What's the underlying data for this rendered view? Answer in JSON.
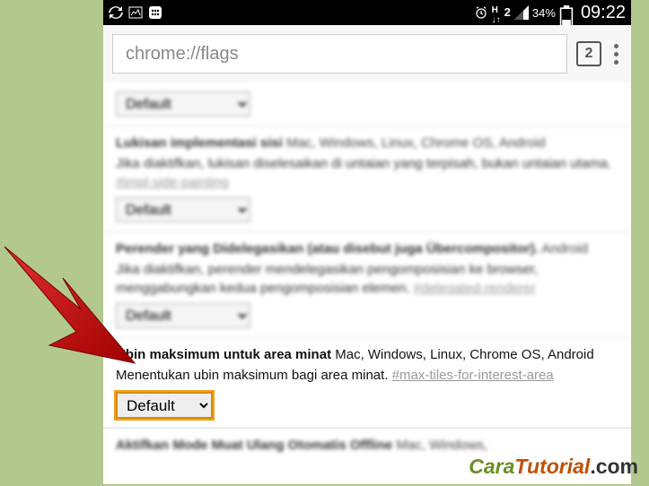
{
  "statusbar": {
    "battery": "34%",
    "time": "09:22"
  },
  "url_row": {
    "url_text": "chrome://flags",
    "tabs_count": "2"
  },
  "flags": {
    "cut": {
      "select": "Default"
    },
    "f1": {
      "title": "Lukisan implementasi sisi",
      "platforms": " Mac, Windows, Linux, Chrome OS, Android",
      "desc": "Jika diaktifkan, lukisan diselesaikan di untaian yang terpisah, bukan untaian utama. ",
      "link": "#impl-side-painting",
      "select": "Default"
    },
    "f2": {
      "title": "Perender yang Didelegasikan (atau disebut juga Übercompositor).",
      "platforms": " Android",
      "desc": "Jika diaktifkan, perender mendelegasikan pengomposisian ke browser, menggabungkan kedua pengomposisian elemen. ",
      "link": "#delegated-renderer",
      "select": "Default"
    },
    "focused": {
      "title": "Ubin maksimum untuk area minat",
      "platforms": " Mac, Windows, Linux, Chrome OS, Android",
      "desc": "Menentukan ubin maksimum bagi area minat. ",
      "link": "#max-tiles-for-interest-area",
      "select": "Default"
    },
    "f4": {
      "title": "Aktifkan Mode Muat Ulang Otomatis Offline",
      "platforms": " Mac, Windows,"
    }
  },
  "watermark": {
    "part1": "Cara",
    "part2": "Tutorial",
    "part3": ".com"
  }
}
